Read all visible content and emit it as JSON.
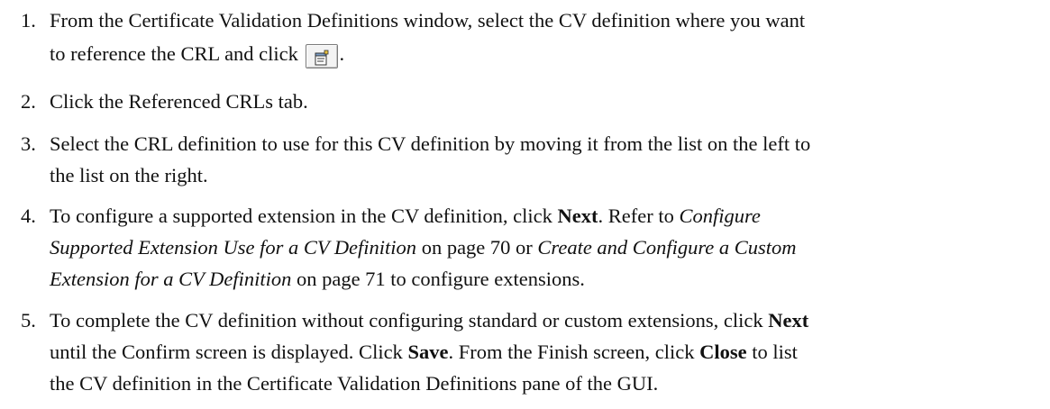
{
  "steps": [
    {
      "number": "1.",
      "line1": "From the Certificate Validation Definitions window, select the CV definition where you want",
      "line2_before": "to reference the CRL and click",
      "icon": "properties-icon",
      "line2_after": "."
    },
    {
      "number": "2.",
      "text": "Click the Referenced CRLs tab."
    },
    {
      "number": "3.",
      "line1": "Select the CRL definition to use for this CV definition by moving it from the list on the left to",
      "line2": "the list on the right."
    },
    {
      "number": "4.",
      "l1_a": "To configure a supported extension in the CV definition, click ",
      "l1_b": "Next",
      "l1_c": ". Refer to ",
      "l1_d": "Configure",
      "l2_a": "Supported Extension Use for a CV Definition",
      "l2_b": " on page 70 or ",
      "l2_c": "Create and Configure a Custom",
      "l3_a": "Extension for a CV Definition",
      "l3_b": " on page 71 to configure extensions."
    },
    {
      "number": "5.",
      "l1_a": "To complete the CV definition without configuring standard or custom extensions, click ",
      "l1_b": "Next",
      "l2_a": "until the Confirm screen is displayed. Click ",
      "l2_b": "Save",
      "l2_c": ". From the Finish screen, click ",
      "l2_d": "Close",
      "l2_e": " to list",
      "l3": "the CV definition in the Certificate Validation Definitions pane of the GUI."
    }
  ]
}
